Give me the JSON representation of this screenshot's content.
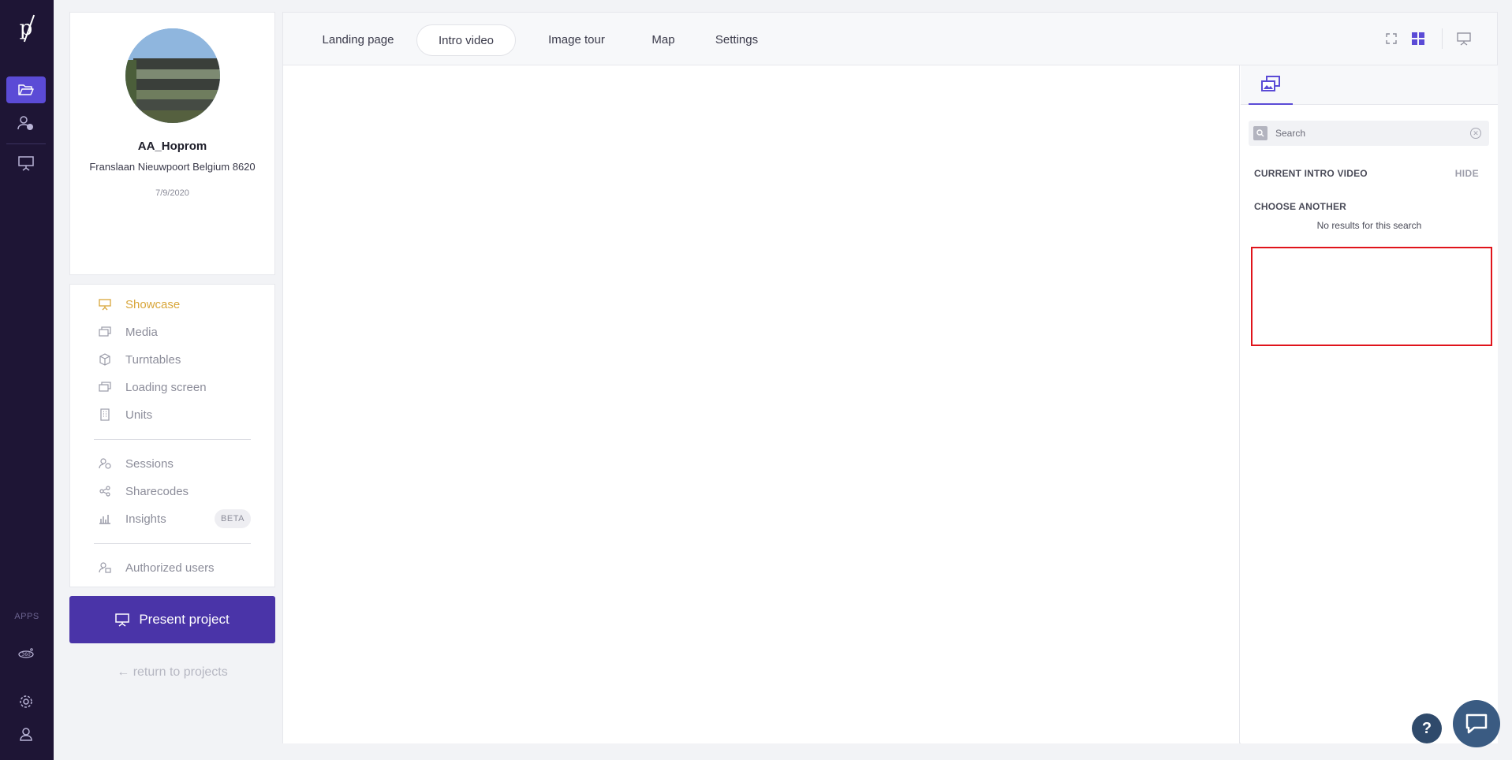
{
  "rail": {
    "logo": "p",
    "apps_label": "APPS"
  },
  "project": {
    "name": "AA_Hoprom",
    "address": "Franslaan Nieuwpoort Belgium 8620",
    "date": "7/9/2020"
  },
  "nav": {
    "items": [
      {
        "label": "Showcase"
      },
      {
        "label": "Media"
      },
      {
        "label": "Turntables"
      },
      {
        "label": "Loading screen"
      },
      {
        "label": "Units"
      },
      {
        "label": "Sessions"
      },
      {
        "label": "Sharecodes"
      },
      {
        "label": "Insights"
      },
      {
        "label": "Authorized users"
      }
    ],
    "beta_badge": "BETA",
    "active_color": "#d8a63a"
  },
  "present_button": "Present project",
  "return_link": "← return to projects",
  "tabs": [
    {
      "label": "Landing page"
    },
    {
      "label": "Intro video"
    },
    {
      "label": "Image tour"
    },
    {
      "label": "Map"
    },
    {
      "label": "Settings"
    }
  ],
  "panel": {
    "search_placeholder": "Search",
    "current_title": "CURRENT INTRO VIDEO",
    "hide_label": "HIDE",
    "choose_title": "CHOOSE ANOTHER",
    "no_results": "No results for this search"
  },
  "help_label": "?",
  "colors": {
    "rail": "#1e1535",
    "accent": "#5b4bd6",
    "present": "#4a34a8",
    "highlight": "#e0141b"
  }
}
